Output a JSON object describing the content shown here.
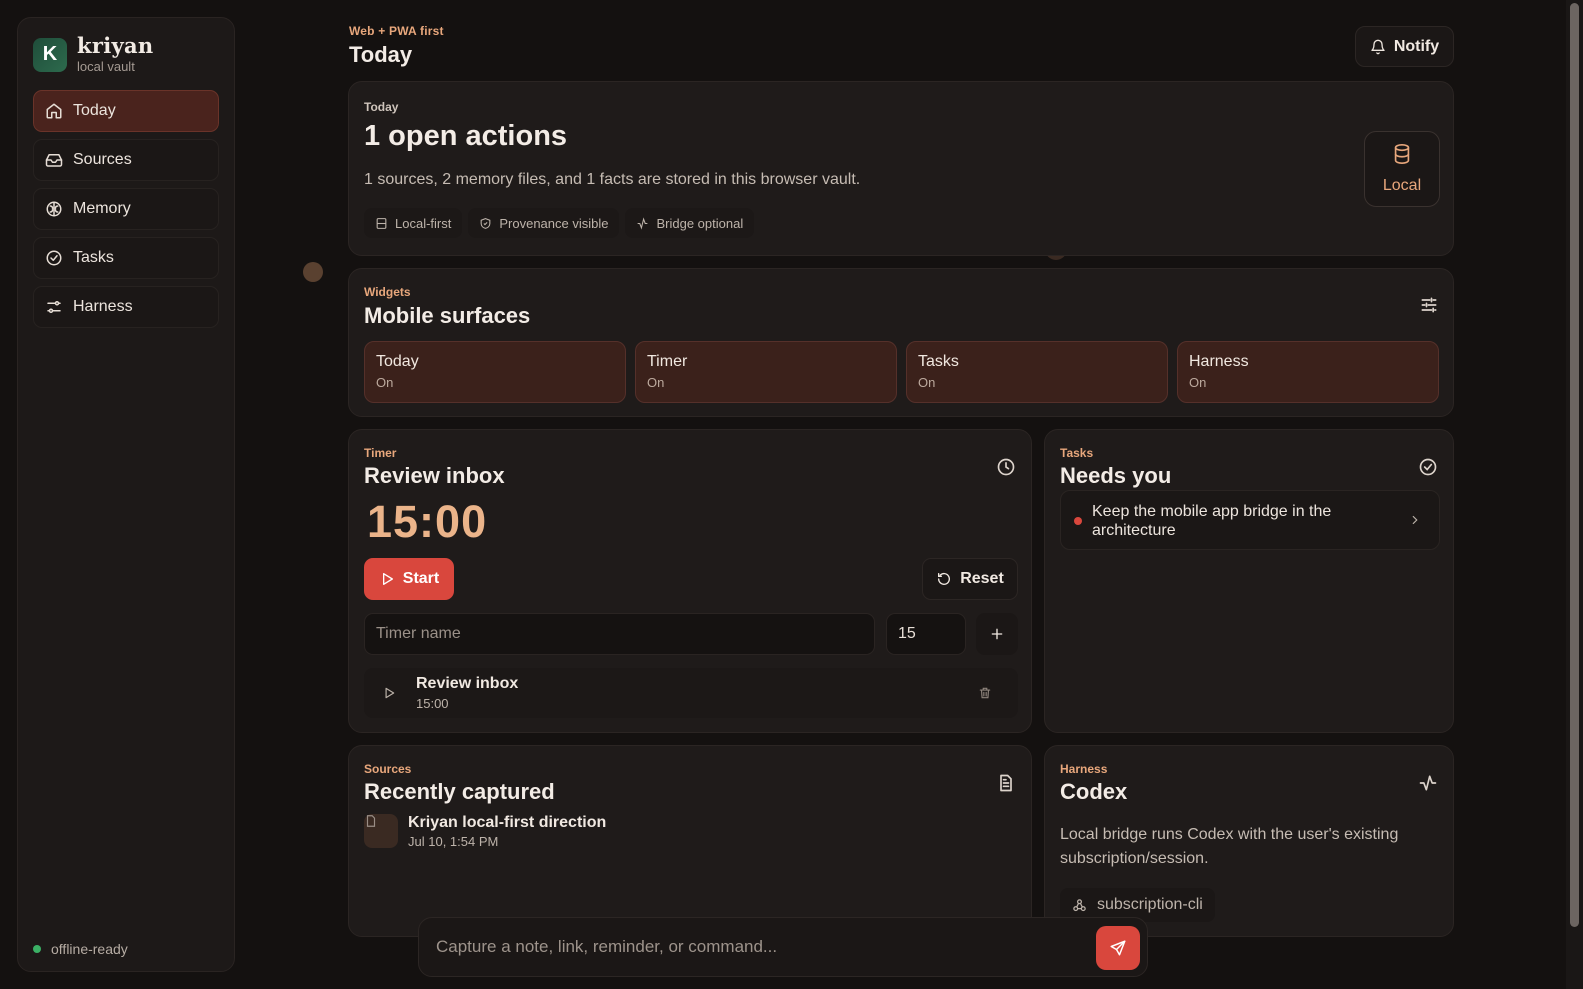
{
  "brand": {
    "logo_letter": "K",
    "name": "kriyan",
    "subtitle": "local vault"
  },
  "nav": [
    {
      "label": "Today",
      "icon": "home-icon",
      "active": true
    },
    {
      "label": "Sources",
      "icon": "inbox-icon",
      "active": false
    },
    {
      "label": "Memory",
      "icon": "brain-icon",
      "active": false
    },
    {
      "label": "Tasks",
      "icon": "check-circle-icon",
      "active": false
    },
    {
      "label": "Harness",
      "icon": "sliders-icon",
      "active": false
    }
  ],
  "status": {
    "offline_label": "offline-ready"
  },
  "header": {
    "eyebrow": "Web + PWA first",
    "title": "Today",
    "notify_label": "Notify"
  },
  "today_card": {
    "eyebrow": "Today",
    "title": "1 open actions",
    "summary": "1 sources, 2 memory files, and 1 facts are stored in this browser vault.",
    "chips": [
      "Local-first",
      "Provenance visible",
      "Bridge optional"
    ],
    "storage_label": "Local"
  },
  "widgets_card": {
    "eyebrow": "Widgets",
    "title": "Mobile surfaces",
    "items": [
      {
        "name": "Today",
        "state": "On"
      },
      {
        "name": "Timer",
        "state": "On"
      },
      {
        "name": "Tasks",
        "state": "On"
      },
      {
        "name": "Harness",
        "state": "On"
      }
    ]
  },
  "timer_card": {
    "eyebrow": "Timer",
    "title": "Review inbox",
    "time": "15:00",
    "start_label": "Start",
    "reset_label": "Reset",
    "name_placeholder": "Timer name",
    "minutes_value": "15",
    "list": [
      {
        "name": "Review inbox",
        "duration": "15:00"
      }
    ]
  },
  "tasks_card": {
    "eyebrow": "Tasks",
    "title": "Needs you",
    "items": [
      {
        "text": "Keep the mobile app bridge in the architecture"
      }
    ]
  },
  "sources_card": {
    "eyebrow": "Sources",
    "title": "Recently captured",
    "items": [
      {
        "title": "Kriyan local-first direction",
        "date": "Jul 10, 1:54 PM"
      }
    ]
  },
  "harness_card": {
    "eyebrow": "Harness",
    "title": "Codex",
    "description": "Local bridge runs Codex with the user's existing subscription/session.",
    "mode_label": "subscription-cli"
  },
  "capture": {
    "placeholder": "Capture a note, link, reminder, or command..."
  },
  "colors": {
    "accent": "#e8a77c",
    "primary": "#d9473d",
    "active_nav": "#4a231d",
    "widget": "#3b211b",
    "online": "#3bb065"
  }
}
